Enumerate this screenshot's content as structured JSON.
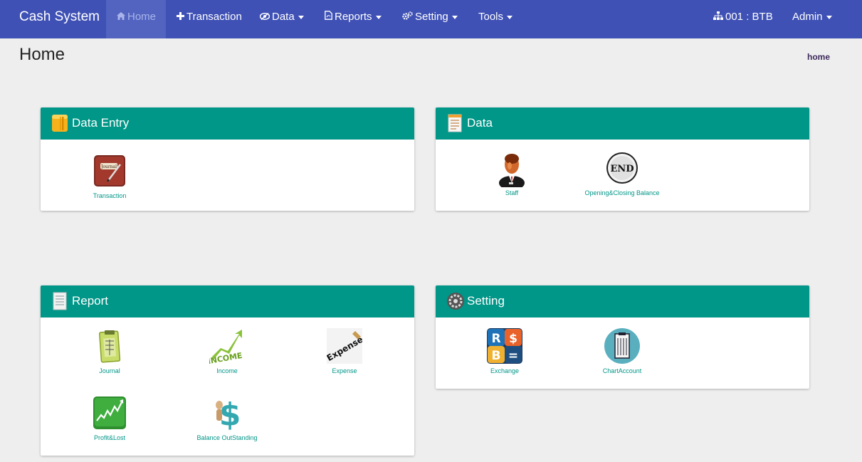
{
  "app": {
    "brand": "Cash System"
  },
  "nav": {
    "home": "Home",
    "transaction": "Transaction",
    "data": "Data",
    "reports": "Reports",
    "setting": "Setting",
    "tools": "Tools",
    "branch": "001 : BTB",
    "user": "Admin"
  },
  "page": {
    "title": "Home",
    "breadcrumb": "home"
  },
  "panels": {
    "data_entry": {
      "title": "Data Entry",
      "items": [
        {
          "label": "Transaction",
          "icon": "journal-book-icon"
        }
      ]
    },
    "data": {
      "title": "Data",
      "items": [
        {
          "label": "Staff",
          "icon": "staff-person-icon"
        },
        {
          "label": "Opening&Closing Balance",
          "icon": "end-button-icon"
        }
      ]
    },
    "report": {
      "title": "Report",
      "items": [
        {
          "label": "Journal",
          "icon": "clipboard-icon"
        },
        {
          "label": "Income",
          "icon": "income-arrow-icon"
        },
        {
          "label": "Expense",
          "icon": "expense-icon"
        },
        {
          "label": "Profit&Lost",
          "icon": "profit-chart-icon"
        },
        {
          "label": "Balance OutStanding",
          "icon": "dollar-icon"
        }
      ]
    },
    "setting": {
      "title": "Setting",
      "items": [
        {
          "label": "Exchange",
          "icon": "exchange-rsb-icon"
        },
        {
          "label": "ChartAccount",
          "icon": "chart-account-icon"
        }
      ]
    }
  },
  "colors": {
    "navbar": "#3f51b5",
    "panel_header": "#009688",
    "link": "#009688",
    "background": "#eeeeee"
  }
}
